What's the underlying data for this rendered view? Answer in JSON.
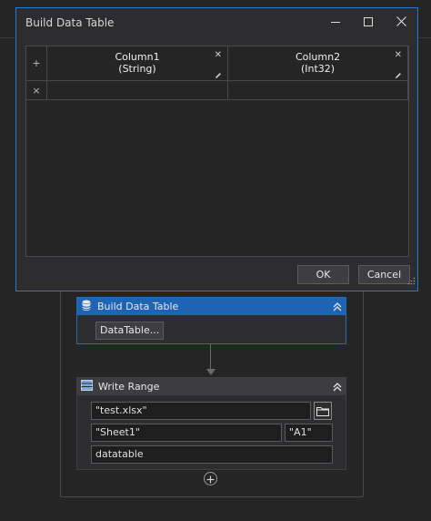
{
  "dialog": {
    "title": "Build Data Table",
    "columns": [
      {
        "name": "Column1",
        "type": "(String)"
      },
      {
        "name": "Column2",
        "type": "(Int32)"
      }
    ],
    "add_row_glyph": "+",
    "delete_row_glyph": "×",
    "ok_label": "OK",
    "cancel_label": "Cancel"
  },
  "workflow": {
    "build": {
      "title": "Build Data Table",
      "button_label": "DataTable..."
    },
    "write": {
      "title": "Write Range",
      "workbook_path": "\"test.xlsx\"",
      "sheet_name": "\"Sheet1\"",
      "starting_cell": "\"A1\"",
      "datatable": "datatable"
    }
  },
  "icons": [
    "minimize-icon",
    "maximize-icon",
    "close-icon",
    "pencil-icon",
    "folder-icon",
    "database-icon",
    "table-icon",
    "collapse-chevron-icon",
    "add-icon",
    "resize-grip-icon"
  ],
  "colors": {
    "accent": "#1c7cd6",
    "selected_header": "#1f64b4",
    "background": "#252526"
  }
}
